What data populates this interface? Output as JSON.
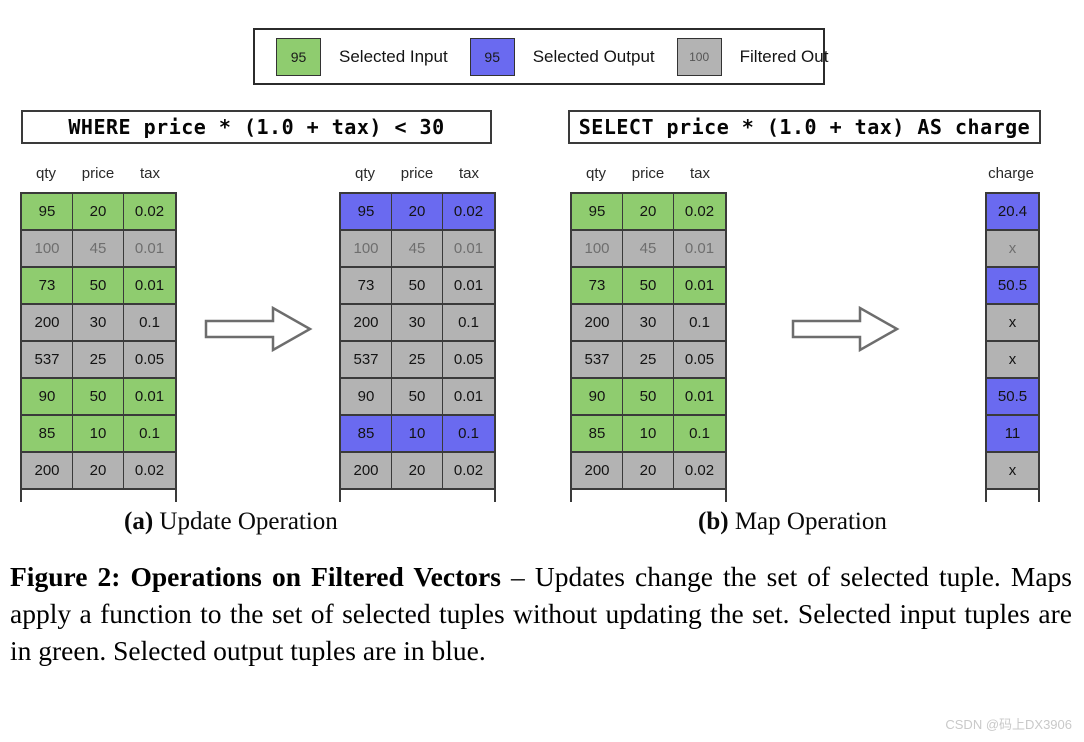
{
  "legend": {
    "items": [
      {
        "value": "95",
        "label": "Selected Input",
        "style": "green",
        "color": "#8FCC6F"
      },
      {
        "value": "95",
        "label": "Selected Output",
        "style": "blue",
        "color": "#6A6AF0"
      },
      {
        "value": "100",
        "label": "Filtered Out",
        "style": "gray",
        "color": "#B3B3B3"
      }
    ]
  },
  "panel_a": {
    "sql": "WHERE price * (1.0 + tax) < 30",
    "input": {
      "headers": [
        "qty",
        "price",
        "tax"
      ],
      "rows": [
        {
          "cells": [
            "95",
            "20",
            "0.02"
          ],
          "style": "green"
        },
        {
          "cells": [
            "100",
            "45",
            "0.01"
          ],
          "style": "gray-faded"
        },
        {
          "cells": [
            "73",
            "50",
            "0.01"
          ],
          "style": "green"
        },
        {
          "cells": [
            "200",
            "30",
            "0.1"
          ],
          "style": "gray"
        },
        {
          "cells": [
            "537",
            "25",
            "0.05"
          ],
          "style": "gray"
        },
        {
          "cells": [
            "90",
            "50",
            "0.01"
          ],
          "style": "green"
        },
        {
          "cells": [
            "85",
            "10",
            "0.1"
          ],
          "style": "green"
        },
        {
          "cells": [
            "200",
            "20",
            "0.02"
          ],
          "style": "gray"
        }
      ]
    },
    "output": {
      "headers": [
        "qty",
        "price",
        "tax"
      ],
      "rows": [
        {
          "cells": [
            "95",
            "20",
            "0.02"
          ],
          "style": "blue"
        },
        {
          "cells": [
            "100",
            "45",
            "0.01"
          ],
          "style": "gray-faded"
        },
        {
          "cells": [
            "73",
            "50",
            "0.01"
          ],
          "style": "gray"
        },
        {
          "cells": [
            "200",
            "30",
            "0.1"
          ],
          "style": "gray"
        },
        {
          "cells": [
            "537",
            "25",
            "0.05"
          ],
          "style": "gray"
        },
        {
          "cells": [
            "90",
            "50",
            "0.01"
          ],
          "style": "gray"
        },
        {
          "cells": [
            "85",
            "10",
            "0.1"
          ],
          "style": "blue"
        },
        {
          "cells": [
            "200",
            "20",
            "0.02"
          ],
          "style": "gray"
        }
      ]
    },
    "arrow_icon": "right-block-arrow-icon",
    "subcaption_label": "(a)",
    "subcaption_text": " Update Operation"
  },
  "panel_b": {
    "sql": "SELECT price * (1.0 + tax) AS charge",
    "input": {
      "headers": [
        "qty",
        "price",
        "tax"
      ],
      "rows": [
        {
          "cells": [
            "95",
            "20",
            "0.02"
          ],
          "style": "green"
        },
        {
          "cells": [
            "100",
            "45",
            "0.01"
          ],
          "style": "gray-faded"
        },
        {
          "cells": [
            "73",
            "50",
            "0.01"
          ],
          "style": "green"
        },
        {
          "cells": [
            "200",
            "30",
            "0.1"
          ],
          "style": "gray"
        },
        {
          "cells": [
            "537",
            "25",
            "0.05"
          ],
          "style": "gray"
        },
        {
          "cells": [
            "90",
            "50",
            "0.01"
          ],
          "style": "green"
        },
        {
          "cells": [
            "85",
            "10",
            "0.1"
          ],
          "style": "green"
        },
        {
          "cells": [
            "200",
            "20",
            "0.02"
          ],
          "style": "gray"
        }
      ]
    },
    "output": {
      "headers": [
        "charge"
      ],
      "rows": [
        {
          "cells": [
            "20.4"
          ],
          "style": "blue"
        },
        {
          "cells": [
            "x"
          ],
          "style": "gray-faded"
        },
        {
          "cells": [
            "50.5"
          ],
          "style": "blue"
        },
        {
          "cells": [
            "x"
          ],
          "style": "gray"
        },
        {
          "cells": [
            "x"
          ],
          "style": "gray"
        },
        {
          "cells": [
            "50.5"
          ],
          "style": "blue"
        },
        {
          "cells": [
            "11"
          ],
          "style": "blue"
        },
        {
          "cells": [
            "x"
          ],
          "style": "gray"
        }
      ]
    },
    "arrow_icon": "right-block-arrow-icon",
    "subcaption_label": "(b)",
    "subcaption_text": " Map Operation"
  },
  "caption": {
    "title": "Figure 2: Operations on Filtered Vectors",
    "body": " – Updates change the set of selected tuple. Maps apply a function to the set of selected tuples without updating the set. Selected input tuples are in green. Selected output tuples are in blue."
  },
  "watermark": "CSDN @码上DX3906"
}
